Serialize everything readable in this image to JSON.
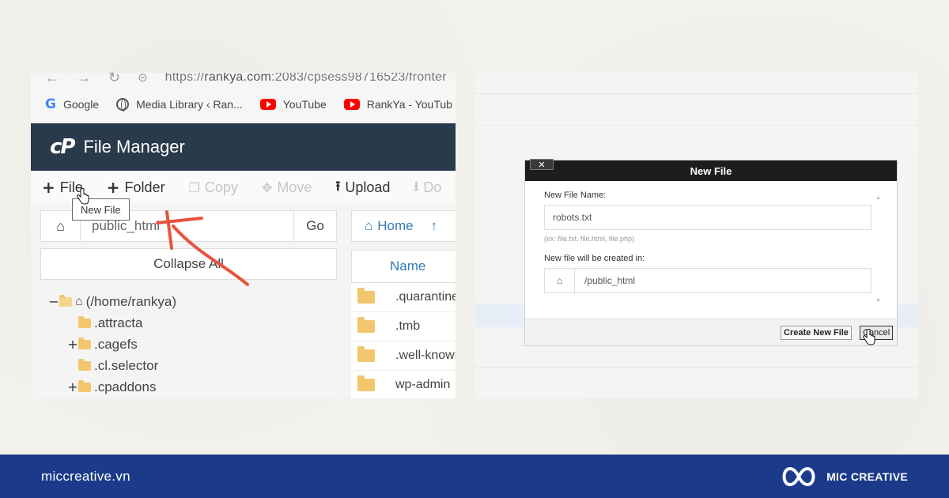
{
  "browser": {
    "url_prefix": "https://",
    "url_host": "rankya.com",
    "url_rest": ":2083/cpsess98716523/fronter",
    "bookmarks": [
      {
        "label": "Google",
        "icon": "google-icon"
      },
      {
        "label": "Media Library ‹ Ran...",
        "icon": "globe-icon"
      },
      {
        "label": "YouTube",
        "icon": "youtube-icon"
      },
      {
        "label": "RankYa - YouTub",
        "icon": "youtube-icon"
      }
    ]
  },
  "file_manager": {
    "logo": "cP",
    "title": "File Manager",
    "toolbar": {
      "file": "File",
      "folder": "Folder",
      "copy": "Copy",
      "move": "Move",
      "upload": "Upload",
      "download": "Do"
    },
    "tooltip": "New File",
    "path_value": "public_html",
    "go_label": "Go",
    "collapse_label": "Collapse All",
    "tree": [
      {
        "toggle": "−",
        "label": "(/home/rankya)"
      },
      {
        "toggle": "",
        "label": ".attracta"
      },
      {
        "toggle": "+",
        "label": ".cagefs"
      },
      {
        "toggle": "",
        "label": ".cl.selector"
      },
      {
        "toggle": "+",
        "label": ".cpaddons"
      }
    ],
    "home_nav": "Home",
    "list_header": "Name",
    "list_items": [
      ".quarantine",
      ".tmb",
      ".well-known",
      "wp-admin"
    ]
  },
  "dialog": {
    "title": "New File",
    "close_label": "✕",
    "name_label": "New File Name:",
    "name_value": "robots.txt",
    "hint": "(ex: file.txt, file.html, file.php)",
    "location_label": "New file will be created in:",
    "location_value": "/public_html",
    "create_button": "Create New File",
    "cancel_button": "Cancel"
  },
  "footer": {
    "site": "miccreative.vn",
    "brand": "MIC CREATIVE"
  },
  "colors": {
    "cpanel_header": "#293a4a",
    "footer_bg": "#1b3b8a",
    "link_blue": "#337ab7",
    "annotation_arrow": "#e8533f"
  }
}
